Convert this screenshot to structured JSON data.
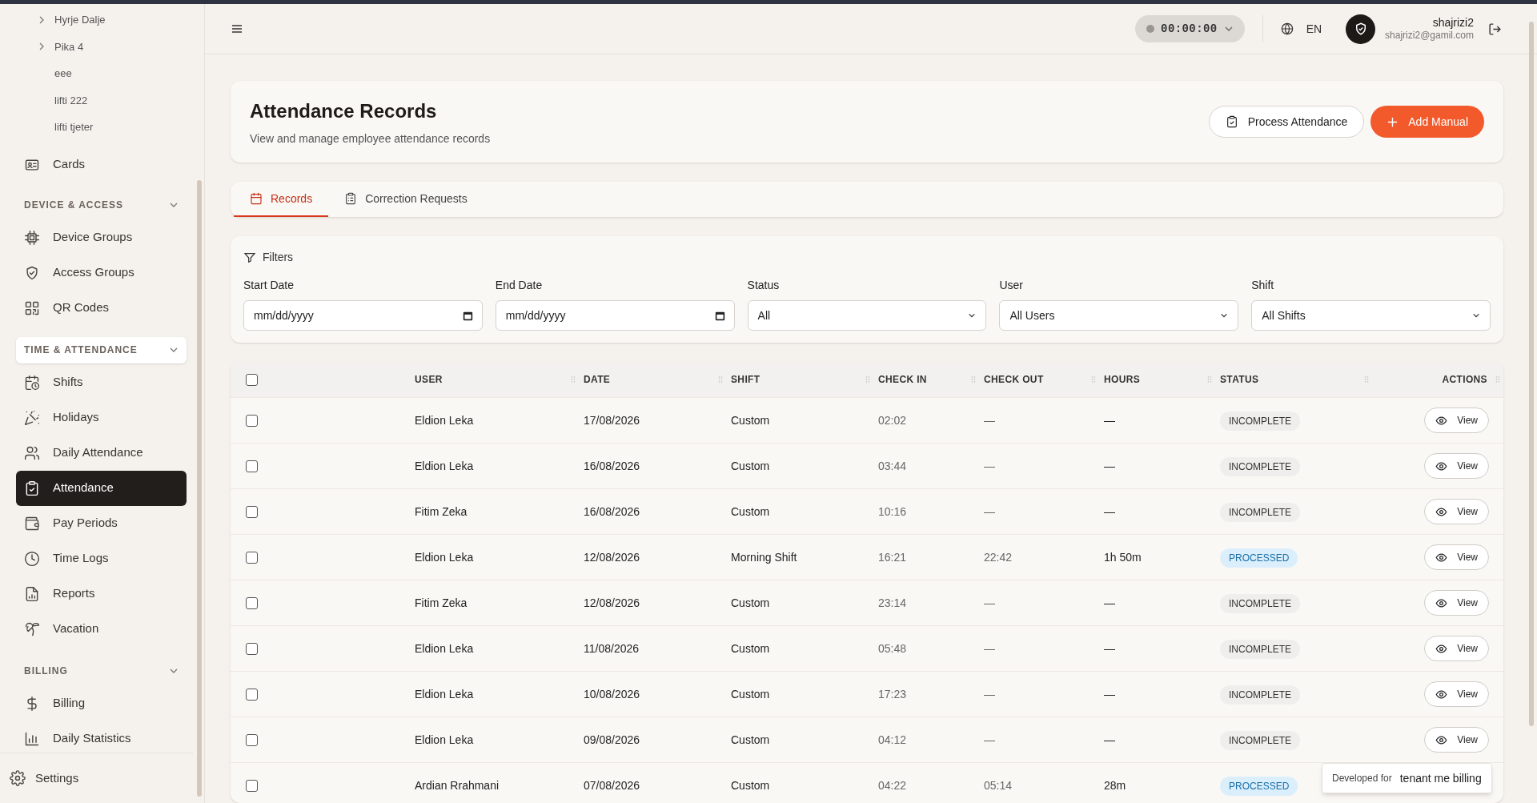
{
  "sidebar": {
    "tree": [
      {
        "label": "Hyrje Dalje",
        "kind": "folder"
      },
      {
        "label": "Pika 4",
        "kind": "folder"
      },
      {
        "label": "eee",
        "kind": "leaf"
      },
      {
        "label": "lifti 222",
        "kind": "leaf"
      },
      {
        "label": "lifti tjeter",
        "kind": "leaf"
      }
    ],
    "top_items": [
      {
        "label": "Cards",
        "selected": false
      }
    ],
    "sections": [
      {
        "title": "DEVICE & ACCESS",
        "expanded": true,
        "active": false,
        "items": [
          {
            "label": "Device Groups",
            "selected": false
          },
          {
            "label": "Access Groups",
            "selected": false
          },
          {
            "label": "QR Codes",
            "selected": false
          }
        ]
      },
      {
        "title": "TIME & ATTENDANCE",
        "expanded": true,
        "active": true,
        "items": [
          {
            "label": "Shifts",
            "selected": false
          },
          {
            "label": "Holidays",
            "selected": false
          },
          {
            "label": "Daily Attendance",
            "selected": false
          },
          {
            "label": "Attendance",
            "selected": true
          },
          {
            "label": "Pay Periods",
            "selected": false
          },
          {
            "label": "Time Logs",
            "selected": false
          },
          {
            "label": "Reports",
            "selected": false
          },
          {
            "label": "Vacation",
            "selected": false
          }
        ]
      },
      {
        "title": "BILLING",
        "expanded": true,
        "active": false,
        "items": [
          {
            "label": "Billing",
            "selected": false
          },
          {
            "label": "Daily Statistics",
            "selected": false
          }
        ]
      }
    ],
    "footer": {
      "label": "Settings"
    }
  },
  "header": {
    "timer": {
      "time": "00:00:00",
      "running": false
    },
    "language": "EN",
    "user": {
      "name": "shajrizi2",
      "email": "shajrizi2@gamil.com"
    }
  },
  "page": {
    "title": "Attendance Records",
    "subtitle": "View and manage employee attendance records",
    "buttons": [
      {
        "label": "Process Attendance",
        "kind": "secondary"
      },
      {
        "label": "Add Manual",
        "kind": "primary"
      }
    ]
  },
  "tabs": [
    {
      "label": "Records",
      "selected": true
    },
    {
      "label": "Correction Requests",
      "selected": false
    }
  ],
  "filters": {
    "title": "Filters",
    "fields": [
      {
        "label": "Start Date",
        "kind": "date",
        "placeholder": "mm/dd/yyyy"
      },
      {
        "label": "End Date",
        "kind": "date",
        "placeholder": "mm/dd/yyyy"
      },
      {
        "label": "Status",
        "kind": "select",
        "value": "All"
      },
      {
        "label": "User",
        "kind": "select",
        "value": "All Users"
      },
      {
        "label": "Shift",
        "kind": "select",
        "value": "All Shifts"
      }
    ]
  },
  "table": {
    "all_checked": false,
    "columns": [
      "USER",
      "DATE",
      "SHIFT",
      "CHECK IN",
      "CHECK OUT",
      "HOURS",
      "STATUS",
      "ACTIONS"
    ],
    "rows": [
      {
        "checked": false,
        "user": "Eldion Leka",
        "date": "17/08/2026",
        "shift": "Custom",
        "check_in": "02:02",
        "check_out": "—",
        "hours": "—",
        "status": {
          "label": "INCOMPLETE",
          "kind": "incomplete"
        },
        "action": "View"
      },
      {
        "checked": false,
        "user": "Eldion Leka",
        "date": "16/08/2026",
        "shift": "Custom",
        "check_in": "03:44",
        "check_out": "—",
        "hours": "—",
        "status": {
          "label": "INCOMPLETE",
          "kind": "incomplete"
        },
        "action": "View"
      },
      {
        "checked": false,
        "user": "Fitim Zeka",
        "date": "16/08/2026",
        "shift": "Custom",
        "check_in": "10:16",
        "check_out": "—",
        "hours": "—",
        "status": {
          "label": "INCOMPLETE",
          "kind": "incomplete"
        },
        "action": "View"
      },
      {
        "checked": false,
        "user": "Eldion Leka",
        "date": "12/08/2026",
        "shift": "Morning Shift",
        "check_in": "16:21",
        "check_out": "22:42",
        "hours": "1h 50m",
        "status": {
          "label": "PROCESSED",
          "kind": "processed"
        },
        "action": "View"
      },
      {
        "checked": false,
        "user": "Fitim Zeka",
        "date": "12/08/2026",
        "shift": "Custom",
        "check_in": "23:14",
        "check_out": "—",
        "hours": "—",
        "status": {
          "label": "INCOMPLETE",
          "kind": "incomplete"
        },
        "action": "View"
      },
      {
        "checked": false,
        "user": "Eldion Leka",
        "date": "11/08/2026",
        "shift": "Custom",
        "check_in": "05:48",
        "check_out": "—",
        "hours": "—",
        "status": {
          "label": "INCOMPLETE",
          "kind": "incomplete"
        },
        "action": "View"
      },
      {
        "checked": false,
        "user": "Eldion Leka",
        "date": "10/08/2026",
        "shift": "Custom",
        "check_in": "17:23",
        "check_out": "—",
        "hours": "—",
        "status": {
          "label": "INCOMPLETE",
          "kind": "incomplete"
        },
        "action": "View"
      },
      {
        "checked": false,
        "user": "Eldion Leka",
        "date": "09/08/2026",
        "shift": "Custom",
        "check_in": "04:12",
        "check_out": "—",
        "hours": "—",
        "status": {
          "label": "INCOMPLETE",
          "kind": "incomplete"
        },
        "action": "View"
      },
      {
        "checked": false,
        "user": "Ardian Rrahmani",
        "date": "07/08/2026",
        "shift": "Custom",
        "check_in": "04:22",
        "check_out": "05:14",
        "hours": "28m",
        "status": {
          "label": "PROCESSED",
          "kind": "processed"
        }
      }
    ]
  },
  "toast": {
    "caption": "Developed for",
    "text": "tenant me billing"
  }
}
